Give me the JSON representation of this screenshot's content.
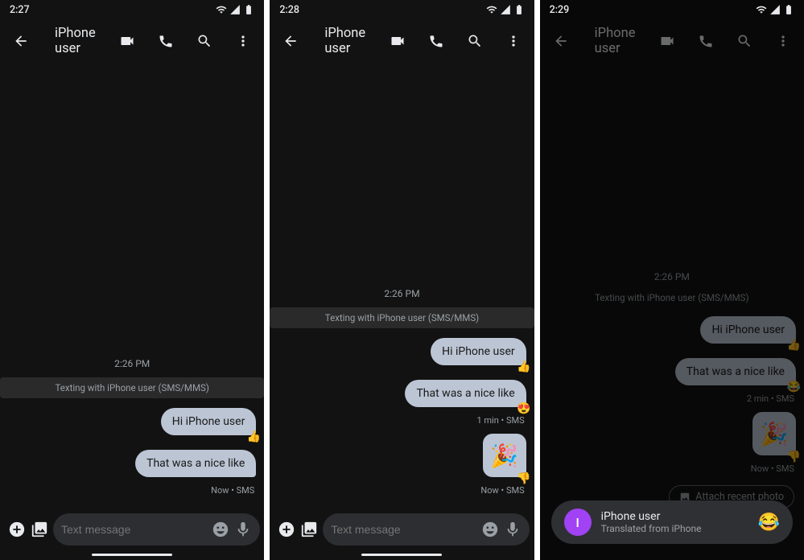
{
  "screens": [
    {
      "status_time": "2:27",
      "contact": "iPhone user",
      "thread_time": "2:26 PM",
      "banner": "Texting with iPhone user (SMS/MMS)",
      "messages": [
        {
          "text": "Hi iPhone user",
          "reaction": "👍"
        },
        {
          "text": "That was a nice like",
          "reaction": ""
        }
      ],
      "meta": "Now • SMS",
      "composer_placeholder": "Text message"
    },
    {
      "status_time": "2:28",
      "contact": "iPhone user",
      "thread_time": "2:26 PM",
      "banner": "Texting with iPhone user (SMS/MMS)",
      "messages": [
        {
          "text": "Hi iPhone user",
          "reaction": "👍"
        },
        {
          "text": "That was a nice like",
          "reaction": "😍"
        }
      ],
      "meta1": "1 min • SMS",
      "image_msg": "🎉",
      "image_reaction": "👎",
      "meta2": "Now • SMS",
      "composer_placeholder": "Text message"
    },
    {
      "status_time": "2:29",
      "contact": "iPhone user",
      "thread_time": "2:26 PM",
      "banner": "Texting with iPhone user (SMS/MMS)",
      "messages": [
        {
          "text": "Hi iPhone user",
          "reaction": "👍"
        },
        {
          "text": "That was a nice like",
          "reaction": "😂"
        }
      ],
      "meta1": "2 min • SMS",
      "image_msg": "🎉",
      "image_reaction": "👎",
      "meta2": "Now • SMS",
      "attach_label": "Attach recent photo",
      "popup": {
        "avatar_letter": "I",
        "name": "iPhone user",
        "subtitle": "Translated from iPhone",
        "emoji": "😂"
      }
    }
  ]
}
